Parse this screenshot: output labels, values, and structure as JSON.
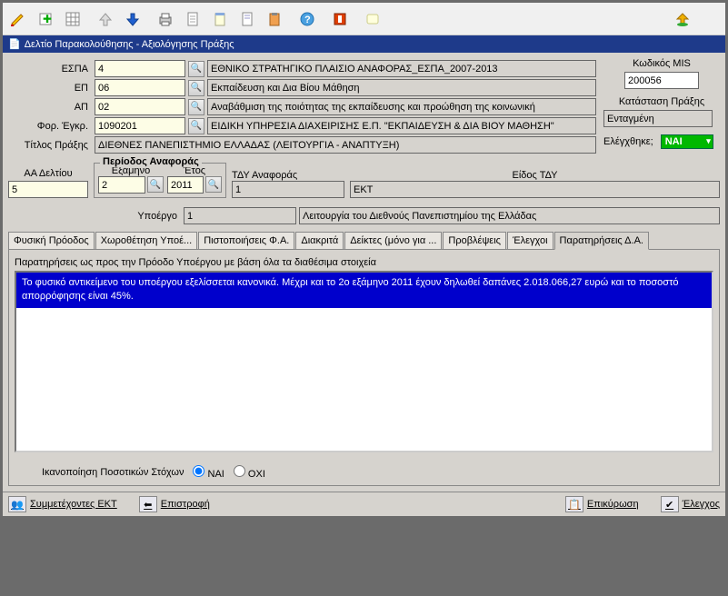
{
  "window_title": "Δελτίο Παρακολούθησης - Αξιολόγησης Πράξης",
  "form": {
    "espa_label": "ΕΣΠΑ",
    "espa_code": "4",
    "espa_desc": "ΕΘΝΙΚΟ ΣΤΡΑΤΗΓΙΚΟ ΠΛΑΙΣΙΟ ΑΝΑΦΟΡΑΣ_ΕΣΠΑ_2007-2013",
    "ep_label": "ΕΠ",
    "ep_code": "06",
    "ep_desc": "Εκπαίδευση και Δια Βίου Μάθηση",
    "ap_label": "ΑΠ",
    "ap_code": "02",
    "ap_desc": "Αναβάθμιση της ποιότητας της εκπαίδευσης και προώθηση της κοινωνική",
    "for_label": "Φορ. Έγκρ.",
    "for_code": "1090201",
    "for_desc": "ΕΙΔΙΚΗ ΥΠΗΡΕΣΙΑ ΔΙΑΧΕΙΡΙΣΗΣ Ε.Π. \"ΕΚΠΑΙΔΕΥΣΗ & ΔΙΑ ΒΙΟΥ ΜΑΘΗΣΗ\"",
    "title_label": "Τίτλος Πράξης",
    "title_value": "ΔΙΕΘΝΕΣ ΠΑΝΕΠΙΣΤΗΜΙΟ ΕΛΛΑΔΑΣ (ΛΕΙΤΟΥΡΓΙΑ - ΑΝΑΠΤΥΞΗ)"
  },
  "right": {
    "mis_label": "Κωδικός MIS",
    "mis_value": "200056",
    "status_label": "Κατάσταση Πράξης",
    "status_value": "Ενταγμένη",
    "checked_label": "Ελέγχθηκε;",
    "checked_value": "ΝΑΙ"
  },
  "ref": {
    "aa_label": "ΑΑ Δελτίου",
    "aa_value": "5",
    "period_legend": "Περίοδος Αναφοράς",
    "semester_label": "Εξάμηνο",
    "semester_value": "2",
    "year_label": "Έτος",
    "year_value": "2011",
    "tdy_label": "ΤΔΥ Αναφοράς",
    "tdy_value": "1",
    "kind_label": "Είδος ΤΔΥ",
    "kind_value": "ΕΚΤ"
  },
  "subproj": {
    "label": "Υποέργο",
    "code": "1",
    "desc": "Λειτουργία του Διεθνούς Πανεπιστημίου της Ελλάδας"
  },
  "tabs": [
    "Φυσική Πρόοδος",
    "Χωροθέτηση Υποέ...",
    "Πιστοποιήσεις Φ.Α.",
    "Διακριτά",
    "Δείκτες (μόνο για ...",
    "Προβλέψεις",
    "Έλεγχοι",
    "Παρατηρήσεις Δ.Α."
  ],
  "obs_label": "Παρατηρήσεις ως προς την Πρόοδο Υποέργου με βάση όλα τα διαθέσιμα στοιχεία",
  "obs_text": "Το φυσικό αντικείμενο του υποέργου εξελίσσεται κανονικά. Μέχρι και το 2ο εξάμηνο 2011 έχουν δηλωθεί δαπάνες 2.018.066,27 ευρώ και το ποσοστό απορρόφησης είναι 45%.",
  "radio": {
    "label": "Ικανοποίηση Ποσοτικών Στόχων",
    "yes": "ΝΑΙ",
    "no": "ΟΧΙ"
  },
  "footer": {
    "ekt": "Συμμετέχοντες ΕΚΤ",
    "back": "Επιστροφή",
    "validate": "Επικύρωση",
    "check": "Έλεγχος"
  }
}
